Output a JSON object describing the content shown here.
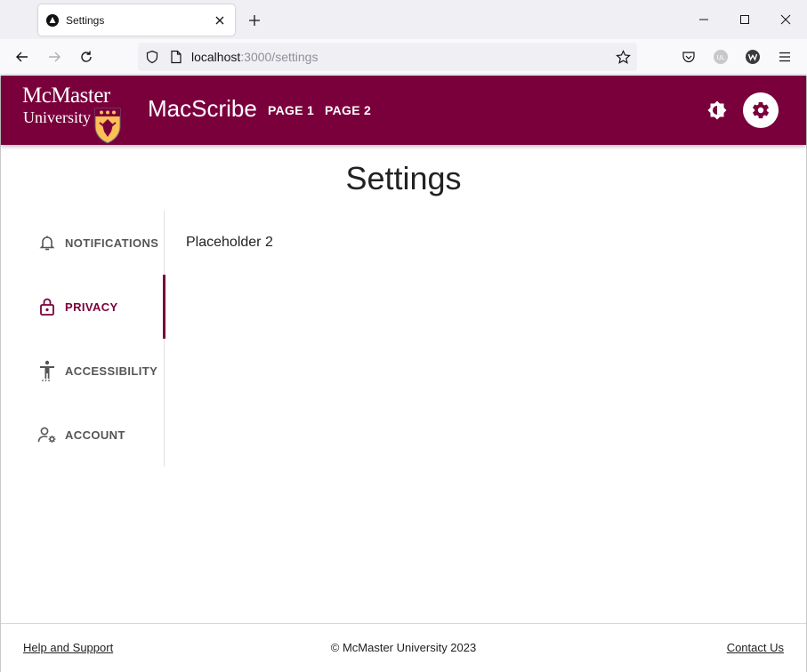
{
  "browser": {
    "tab_title": "Settings",
    "url_host": "localhost",
    "url_rest": ":3000/settings"
  },
  "header": {
    "logo_line1": "McMaster",
    "logo_line2": "University",
    "app_name": "MacScribe",
    "nav": [
      "PAGE 1",
      "PAGE 2"
    ]
  },
  "page": {
    "title": "Settings",
    "content": "Placeholder 2"
  },
  "sidebar": {
    "items": [
      {
        "label": "NOTIFICATIONS",
        "icon": "bell-icon"
      },
      {
        "label": "PRIVACY",
        "icon": "lock-icon",
        "active": true
      },
      {
        "label": "ACCESSIBILITY",
        "icon": "accessibility-icon"
      },
      {
        "label": "ACCOUNT",
        "icon": "account-settings-icon"
      }
    ]
  },
  "footer": {
    "help": "Help and Support",
    "copyright": "© McMaster University 2023",
    "contact": "Contact Us"
  },
  "colors": {
    "brand": "#7a003c",
    "chrome": "#f0f0f4"
  }
}
